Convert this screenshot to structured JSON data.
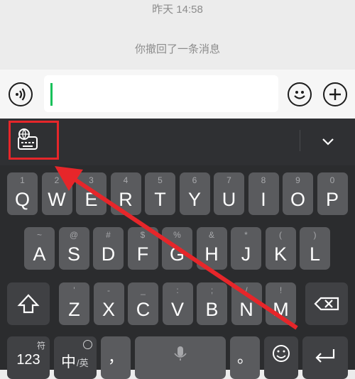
{
  "chat": {
    "timestamp": "昨天 14:58",
    "recall_notice": "你撤回了一条消息"
  },
  "input_bar": {
    "voice_icon": "voice-icon",
    "emoji_icon": "emoji-icon",
    "plus_icon": "plus-icon",
    "text_value": ""
  },
  "toolbar": {
    "keyboard_settings_icon": "globe-keyboard-icon",
    "collapse_icon": "chevron-down-icon"
  },
  "keyboard": {
    "row1": [
      {
        "main": "Q",
        "sub": "1"
      },
      {
        "main": "W",
        "sub": "2"
      },
      {
        "main": "E",
        "sub": "3"
      },
      {
        "main": "R",
        "sub": "4"
      },
      {
        "main": "T",
        "sub": "5"
      },
      {
        "main": "Y",
        "sub": "6"
      },
      {
        "main": "U",
        "sub": "7"
      },
      {
        "main": "I",
        "sub": "8"
      },
      {
        "main": "O",
        "sub": "9"
      },
      {
        "main": "P",
        "sub": "0"
      }
    ],
    "row2": [
      {
        "main": "A",
        "sub": "~"
      },
      {
        "main": "S",
        "sub": "@"
      },
      {
        "main": "D",
        "sub": "#"
      },
      {
        "main": "F",
        "sub": "$"
      },
      {
        "main": "G",
        "sub": "%"
      },
      {
        "main": "H",
        "sub": "&"
      },
      {
        "main": "J",
        "sub": "*"
      },
      {
        "main": "K",
        "sub": "("
      },
      {
        "main": "L",
        "sub": ")"
      }
    ],
    "row3": [
      {
        "main": "Z",
        "sub": "'"
      },
      {
        "main": "X",
        "sub": "-"
      },
      {
        "main": "C",
        "sub": "_"
      },
      {
        "main": "V",
        "sub": ":"
      },
      {
        "main": "B",
        "sub": ";"
      },
      {
        "main": "N",
        "sub": "/"
      },
      {
        "main": "M",
        "sub": "!"
      }
    ],
    "bottom": {
      "num_label": "123",
      "num_sub": "符",
      "lang_label": "中",
      "lang_sub": "/英",
      "comma": "，",
      "period": "。"
    }
  },
  "colors": {
    "highlight": "#e6262a",
    "caret": "#18c15a"
  }
}
